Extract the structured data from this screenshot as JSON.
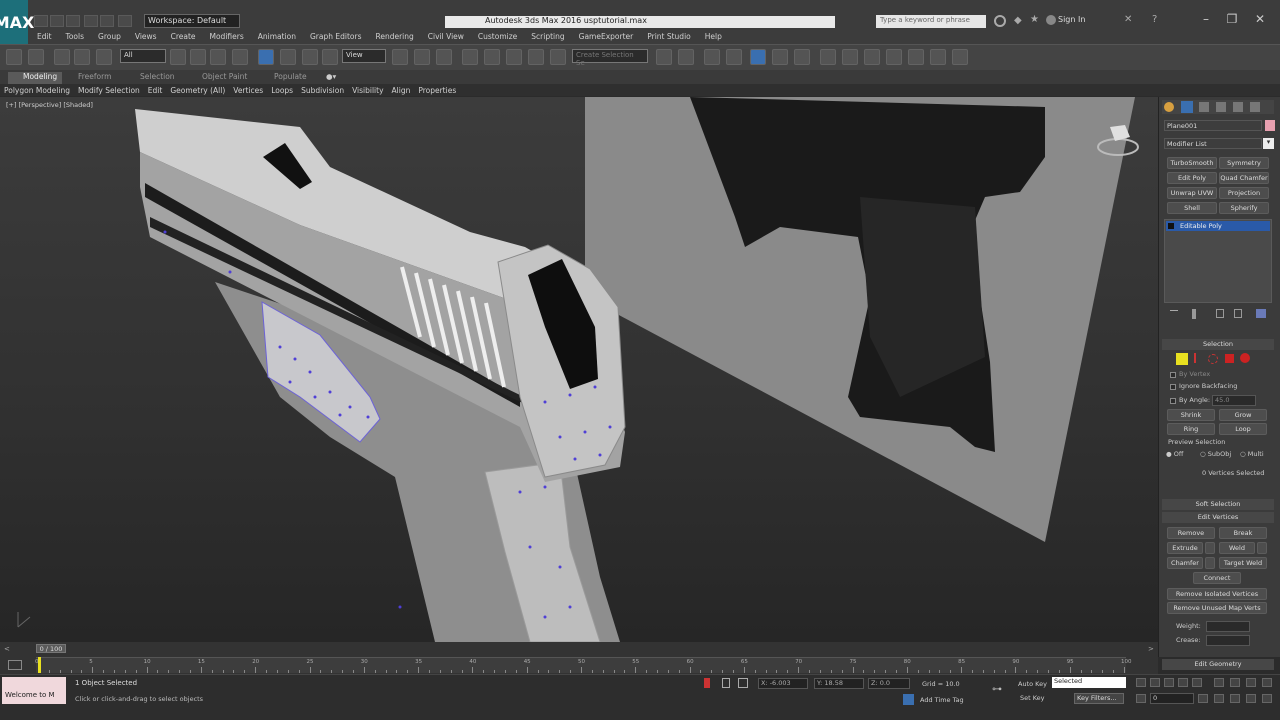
{
  "title_bar": {
    "logo": "MAX",
    "workspace": "Workspace: Default",
    "app_title": "Autodesk 3ds Max 2016    usptutorial.max",
    "search_placeholder": "Type a keyword or phrase",
    "sign_in": "Sign In"
  },
  "menu": [
    "Edit",
    "Tools",
    "Group",
    "Views",
    "Create",
    "Modifiers",
    "Animation",
    "Graph Editors",
    "Rendering",
    "Civil View",
    "Customize",
    "Scripting",
    "GameExporter",
    "Print Studio",
    "Help"
  ],
  "toolbar": {
    "filter_select": "All",
    "ref_coord_select": "View",
    "named_selection_placeholder": "Create Selection Se"
  },
  "ribbon": {
    "tabs": [
      "Modeling",
      "Freeform",
      "Selection",
      "Object Paint",
      "Populate"
    ],
    "subtabs": [
      "Polygon Modeling",
      "Modify Selection",
      "Edit",
      "Geometry (All)",
      "Vertices",
      "Loops",
      "Subdivision",
      "Visibility",
      "Align",
      "Properties"
    ]
  },
  "viewport": {
    "label": "[+] [Perspective] [Shaded]"
  },
  "command_panel": {
    "object_name": "Plane001",
    "modifier_list": "Modifier List",
    "modifier_buttons": [
      [
        "TurboSmooth",
        "Symmetry"
      ],
      [
        "Edit Poly",
        "Quad Chamfer"
      ],
      [
        "Unwrap UVW",
        "Projection"
      ],
      [
        "Shell",
        "Spherify"
      ]
    ],
    "stack_item": "Editable Poly",
    "selection_header": "Selection",
    "by_vertex": "By Vertex",
    "ignore_backfacing": "Ignore Backfacing",
    "by_angle": "By Angle:",
    "by_angle_value": "45.0",
    "shrink": "Shrink",
    "grow": "Grow",
    "ring": "Ring",
    "loop": "Loop",
    "preview_selection": "Preview Selection",
    "preview_options": [
      "Off",
      "SubObj",
      "Multi"
    ],
    "selected_count": "0 Vertices Selected",
    "soft_selection": "Soft Selection",
    "edit_vertices": "Edit Vertices",
    "remove": "Remove",
    "break": "Break",
    "extrude": "Extrude",
    "weld": "Weld",
    "chamfer": "Chamfer",
    "target_weld": "Target Weld",
    "connect": "Connect",
    "remove_isolated": "Remove Isolated Vertices",
    "remove_unused": "Remove Unused Map Verts",
    "weight": "Weight:",
    "crease": "Crease:",
    "edit_geometry": "Edit Geometry"
  },
  "timeline": {
    "frame_display": "0 / 100",
    "ticks": [
      "0",
      "5",
      "10",
      "15",
      "20",
      "25",
      "30",
      "35",
      "40",
      "45",
      "50",
      "55",
      "60",
      "65",
      "70",
      "75",
      "80",
      "85",
      "90",
      "95",
      "100"
    ]
  },
  "status": {
    "maxscript": "Welcome to M",
    "objects_selected": "1 Object Selected",
    "hint": "Click or click-and-drag to select objects",
    "x": "X: -6.003",
    "y": "Y: 18.58",
    "z": "Z: 0.0",
    "grid": "Grid = 10.0",
    "add_time_tag": "Add Time Tag",
    "auto_key": "Auto Key",
    "set_key": "Set Key",
    "selected_dropdown": "Selected",
    "key_filters": "Key Filters...",
    "frame_value": "0"
  },
  "colors": {
    "accent_blue": "#3a6fb0",
    "stack_highlight": "#2a5aa8",
    "vertex_color": "#4f3fd6"
  }
}
